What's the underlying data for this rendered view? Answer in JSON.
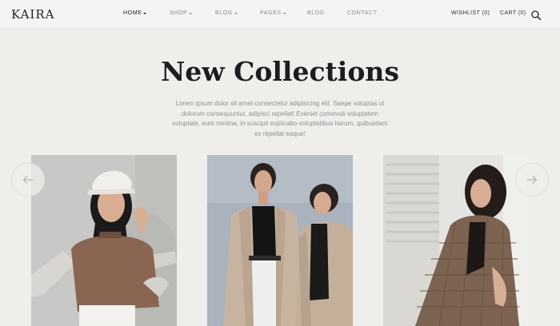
{
  "brand": {
    "logo": "KAIRA"
  },
  "nav": {
    "items": [
      {
        "label": "HOME",
        "dropdown": true,
        "active": true
      },
      {
        "label": "SHOP",
        "dropdown": true,
        "active": false
      },
      {
        "label": "BLOG",
        "dropdown": true,
        "active": false
      },
      {
        "label": "PAGES",
        "dropdown": true,
        "active": false
      },
      {
        "label": "BLOG",
        "dropdown": false,
        "active": false
      },
      {
        "label": "CONTACT",
        "dropdown": false,
        "active": false
      }
    ]
  },
  "utility": {
    "wishlist": "WISHLIST (0)",
    "cart": "CART (0)",
    "search_icon": "search-icon"
  },
  "hero": {
    "title": "New Collections",
    "description_lines": [
      "Lorem ipsum dolor sit amet consectetur adipisicing elit. Saepe voluptas ut",
      "dolorum consequuntur, adipisci repellat! Eveniet commodi voluptatem",
      "voluptate, eum minima, in suscipit explicabo voluptatibus harum, quibusdam",
      "ex repellat eaque!"
    ]
  },
  "carousel": {
    "prev_icon": "arrow-left-icon",
    "next_icon": "arrow-right-icon"
  },
  "colors": {
    "background": "#efeeeb",
    "text": "#222222",
    "muted": "#8f8f8f"
  }
}
